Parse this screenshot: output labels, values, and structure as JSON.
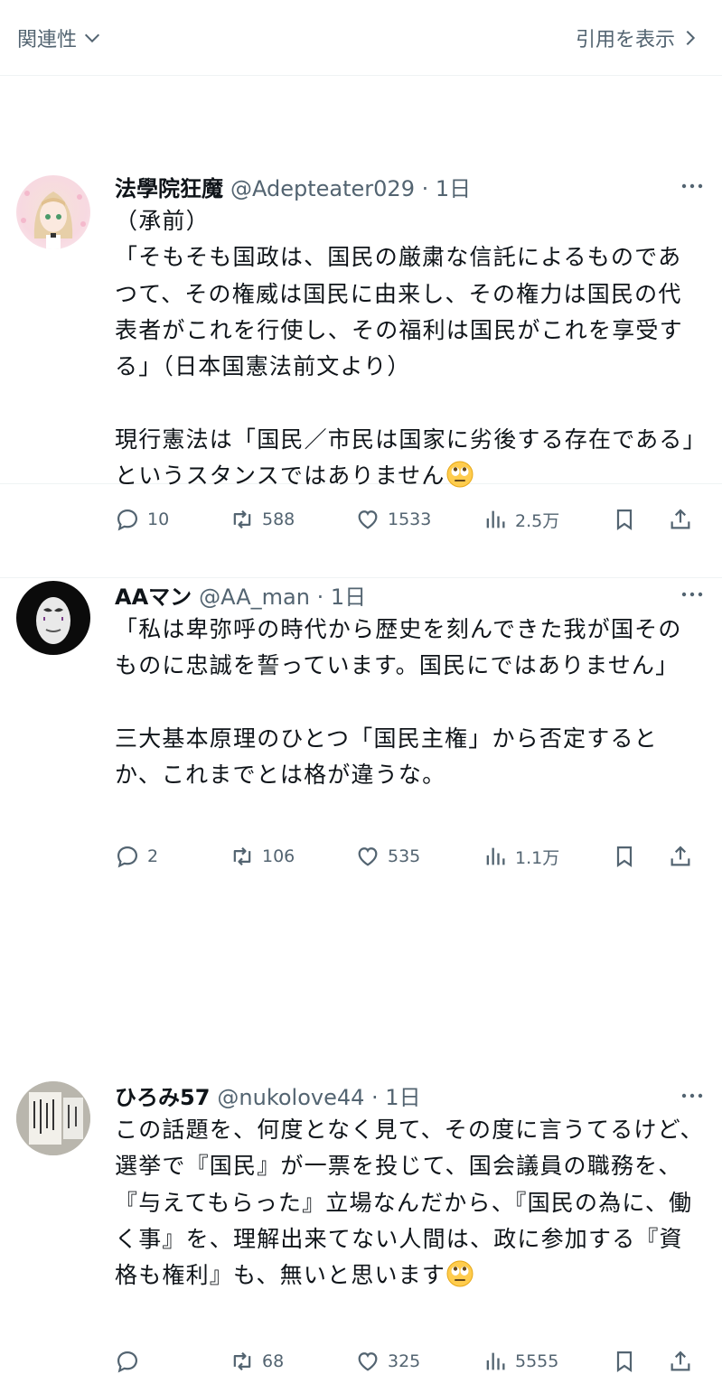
{
  "header": {
    "sort_label": "関連性",
    "quote_link": "引用を表示"
  },
  "tweets": [
    {
      "name": "法學院狂魔",
      "meta": "@Adepteater029 · 1日",
      "text": "（承前）\n「そもそも国政は、国民の厳粛な信託によるものであつて、その権威は国民に由来し、その権力は国民の代表者がこれを行使し、その福利は国民がこれを享受する」（日本国憲法前文より）\n\n現行憲法は「国民／市民は国家に劣後する存在である」というスタンスではありません",
      "emoji": "eye-roll-emoji",
      "replies": "10",
      "retweets": "588",
      "likes": "1533",
      "views": "2.5万"
    },
    {
      "name": "AAマン",
      "meta": "@AA_man · 1日",
      "text": "「私は卑弥呼の時代から歴史を刻んできた我が国そのものに忠誠を誓っています。国民にではありません」\n\n三大基本原理のひとつ「国民主権」から否定するとか、これまでとは格が違うな。",
      "replies": "2",
      "retweets": "106",
      "likes": "535",
      "views": "1.1万"
    },
    {
      "name": "ひろみ57",
      "meta": "@nukolove44 · 1日",
      "text": "この話題を、何度となく見て、その度に言うてるけど、選挙で『国民』が一票を投じて、国会議員の職務を、『与えてもらった』立場なんだから、『国民の為に、働く事』を、理解出来てない人間は、政に参加する『資格も権利』も、無いと思います",
      "emoji": "eye-roll-emoji",
      "replies": "",
      "retweets": "68",
      "likes": "325",
      "views": "5555"
    }
  ]
}
